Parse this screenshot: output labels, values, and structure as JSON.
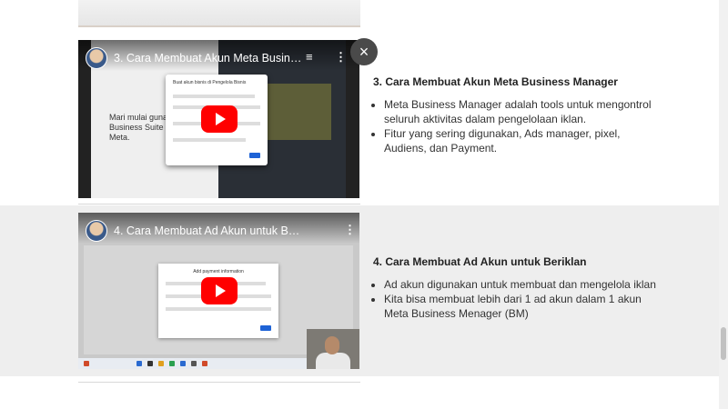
{
  "videos": [
    {
      "title": "3. Cara Membuat Akun Meta Business ...",
      "slide_heading": "Mari mulai gunakan Business Suite dari Meta.",
      "dialog_title": "Buat akun bisnis di Pengelola Bisnis",
      "section_heading": "3. Cara Membuat Akun Meta Business Manager",
      "bullets": [
        "Meta Business Manager adalah tools untuk mengontrol seluruh aktivitas dalam pengelolaan iklan.",
        "Fitur yang sering digunakan, Ads manager, pixel, Audiens, dan Payment."
      ]
    },
    {
      "title": "4. Cara Membuat Ad Akun untuk Beriklan",
      "dialog_title": "Add payment information",
      "section_heading": "4. Cara Membuat Ad Akun untuk Beriklan",
      "bullets": [
        "Ad akun digunakan untuk membuat dan mengelola iklan",
        "Kita bisa membuat lebih dari 1 ad akun dalam 1 akun Meta Business Menager (BM)"
      ]
    }
  ],
  "icons": {
    "close": "×",
    "playlist": "≡",
    "more": "⋮"
  },
  "colors": {
    "youtube_red": "#ff0000",
    "row_alt_bg": "#eeeeee"
  }
}
